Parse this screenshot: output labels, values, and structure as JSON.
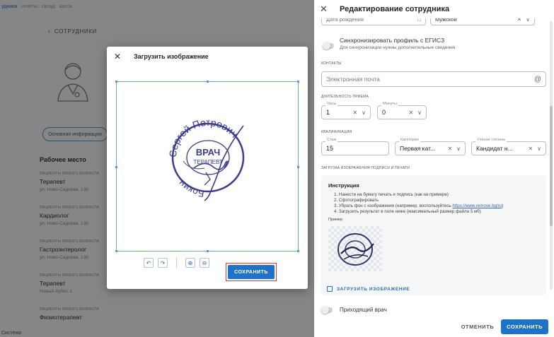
{
  "left_app": {
    "nav": [
      "удника",
      "отчёты",
      "склад",
      "касса"
    ],
    "back_link": "СОТРУДНИКИ",
    "tab_pill": "Основная информация",
    "section_title": "Рабочее место",
    "work_items": [
      {
        "tag": "ПАЦИЕНТЫ ЛЮБОГО ВОЗРАСТА",
        "title": "Терапевт",
        "addr": "ул. Ново-Садовая, 135"
      },
      {
        "tag": "ПАЦИЕНТЫ ЛЮБОГО ВОЗРАСТА",
        "title": "Кардиолог",
        "addr": "ул. Ново-Садовая, 135"
      },
      {
        "tag": "ПАЦИЕНТЫ ЛЮБОГО ВОЗРАСТА",
        "title": "Гастроэнтеролог",
        "addr": "ул. Ново-Садовая, 135"
      },
      {
        "tag": "ПАЦИЕНТЫ ЛЮБОГО ВОЗРАСТА",
        "title": "Терапевт",
        "addr": "Новый Арбат, 1"
      },
      {
        "tag": "ПАЦИЕНТЫ ЛЮБОГО ВОЗРАСТА",
        "title": "Физиотерапевт",
        "addr": ""
      }
    ],
    "footer": "Система"
  },
  "edit_panel": {
    "title": "Редактирование сотрудника",
    "birth_date_placeholder": "Дата рождения",
    "gender_value": "Мужской",
    "sync_label": "Синхронизировать профиль с ЕГИСЗ",
    "sync_hint": "Для синхронизации нужны дополнительные сведения",
    "contacts_caption": "КОНТАКТЫ",
    "email_placeholder": "Электронная почта",
    "duration_caption": "ДЛИТЕЛЬНОСТЬ ПРИЕМА",
    "hours_legend": "Часы",
    "hours_value": "1",
    "minutes_legend": "Минуты",
    "minutes_value": "0",
    "qualification_caption": "КВАЛИФИКАЦИЯ",
    "experience_legend": "Стаж",
    "experience_value": "15",
    "category_legend": "Категория",
    "category_value": "Первая кат...",
    "degree_legend": "Учёная степень",
    "degree_value": "Кандидат н...",
    "upload_caption": "ЗАГРУЗКА ИЗОБРАЖЕНИЯ ПОДПИСИ И ПЕЧАТИ",
    "instruction_title": "Инструкция",
    "instruction_steps": [
      "1. Нанести на бумагу печать и подпись (как на примере)",
      "2. Сфотографировать",
      "3. Убрать фон с изображения (например, воспользуйтесь ",
      "4. Загрузить результат в поле ниже (максимальный размер файла 5 мб)"
    ],
    "instruction_link": "https://www.remove.bg/ru",
    "instruction_link_suffix": ")",
    "example_label": "Пример",
    "upload_button": "ЗАГРУЗИТЬ ИЗОБРАЖЕНИЕ",
    "visiting_doctor": "Приходящий врач",
    "cancel_button": "ОТМЕНИТЬ",
    "save_button": "СОХРАНИТЬ"
  },
  "modal": {
    "title": "Загрузить изображение",
    "save_button": "СОХРАНИТЬ",
    "stamp_text_top": "Сергей Петрович",
    "stamp_text_left": "Бокин",
    "stamp_center_1": "ВРАЧ",
    "stamp_center_2": "ТЕРАПЕВТ"
  },
  "colors": {
    "accent": "#1e73c9",
    "stamp": "#3b3b8f",
    "highlight_border": "#d63b3b"
  }
}
